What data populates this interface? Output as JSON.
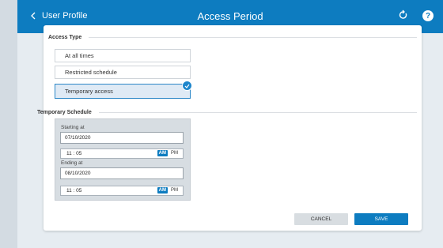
{
  "header": {
    "back_label": "User Profile",
    "title": "Access Period",
    "back_icon": "chevron-left-icon",
    "refresh_icon": "refresh-icon",
    "help_icon": "help-icon",
    "help_glyph": "?"
  },
  "access_type": {
    "heading": "Access Type",
    "options": [
      {
        "label": "At all times",
        "selected": false
      },
      {
        "label": "Restricted schedule",
        "selected": false
      },
      {
        "label": "Temporary access",
        "selected": true
      }
    ]
  },
  "temporary_schedule": {
    "heading": "Temporary Schedule",
    "starting_label": "Starting at",
    "starting_date": "07/10/2020",
    "starting_time": "11 : 05",
    "ending_label": "Ending at",
    "ending_date": "08/10/2020",
    "ending_time": "11 : 05",
    "am_label": "AM",
    "pm_label": "PM"
  },
  "actions": {
    "cancel_label": "CANCEL",
    "save_label": "SAVE"
  },
  "colors": {
    "primary": "#0d7cc0",
    "background": "#e6ecf1"
  }
}
